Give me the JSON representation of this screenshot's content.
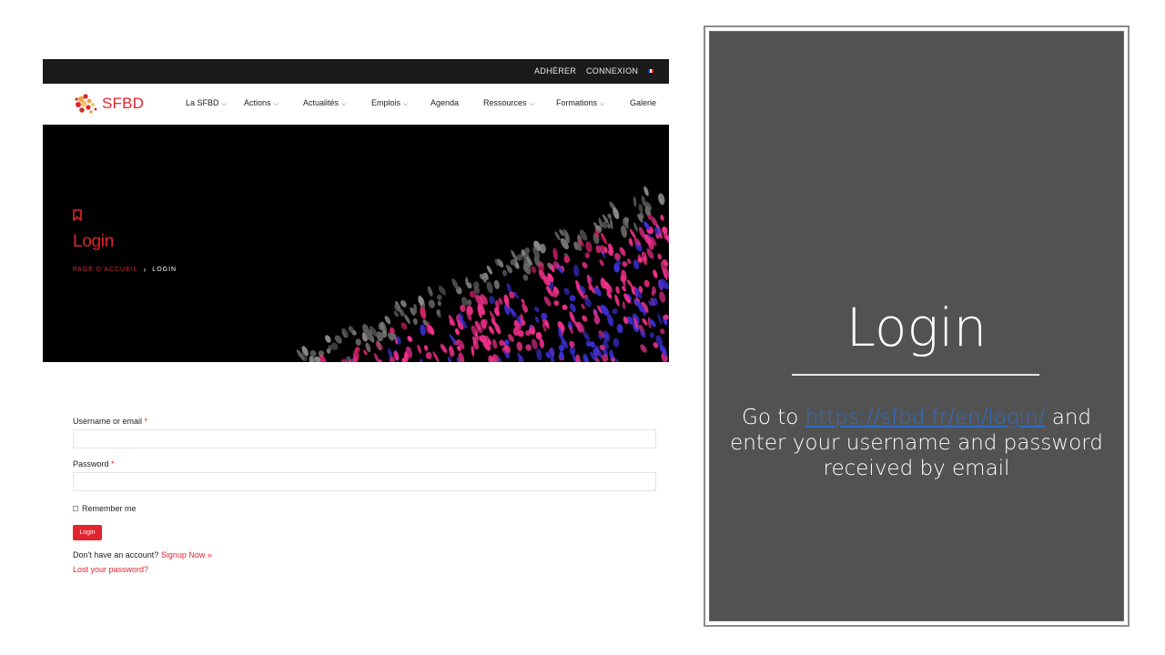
{
  "site": {
    "topbar": {
      "links": [
        "ADHÉRER",
        "CONNEXION"
      ],
      "flag_colors": [
        "#0b3ea8",
        "#ffffff",
        "#e0252e"
      ]
    },
    "logo_text": "SFBD",
    "nav": [
      "La SFBD",
      "Actions",
      "Actualités",
      "Emplois",
      "Agenda",
      "Ressources",
      "Formations",
      "Galerie"
    ],
    "nav_has_dropdown": [
      true,
      true,
      true,
      true,
      false,
      true,
      true,
      false
    ],
    "hero": {
      "title": "Login",
      "breadcrumb_home": "PAGE D'ACCUEIL",
      "breadcrumb_sep": "›",
      "breadcrumb_current": "LOGIN"
    },
    "form": {
      "username_label": "Username or email",
      "password_label": "Password",
      "required_mark": "*",
      "remember_label": "Remember me",
      "login_button": "Login",
      "no_account_text": "Don't have an account?",
      "signup_link": "Signup Now »",
      "lost_password_link": "Lost your password?"
    },
    "accent_color": "#e0252e"
  },
  "slide": {
    "title": "Login",
    "text_prefix": "Go to",
    "link": "https://sfbd.fr/en/login/",
    "text_suffix": "and enter your username and password received by email",
    "panel_color": "#525252"
  }
}
